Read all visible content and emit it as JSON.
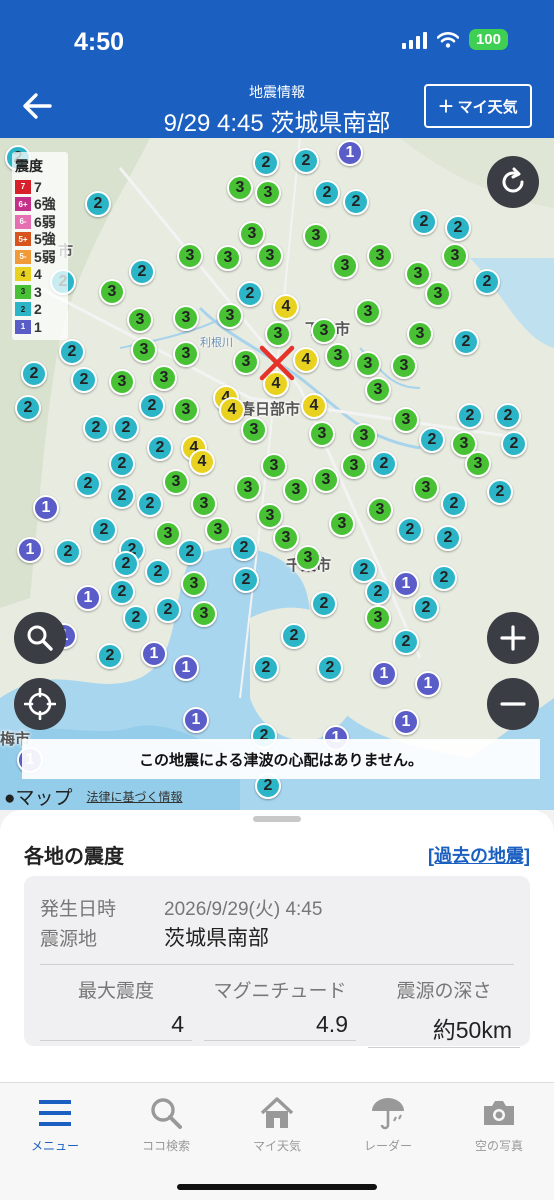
{
  "status_bar": {
    "time": "4:50",
    "battery": "100"
  },
  "header": {
    "subtitle": "地震情報",
    "title": "9/29 4:45 茨城県南部",
    "my_weather_label": "マイ天気"
  },
  "colors": {
    "header_bg": "#1b5fc1",
    "int1": "#5a5cc8",
    "int2": "#2bb5c7",
    "int3": "#48c234",
    "int4": "#e8d21f",
    "link": "#1b5fc1"
  },
  "map": {
    "legend_title": "震度",
    "legend": [
      {
        "sw": "7",
        "label": "7",
        "bg": "#d8202a",
        "fg": "#fff"
      },
      {
        "sw": "6+",
        "label": "6強",
        "bg": "#c42f8a",
        "fg": "#fff"
      },
      {
        "sw": "6-",
        "label": "6弱",
        "bg": "#e56fb0",
        "fg": "#fff"
      },
      {
        "sw": "5+",
        "label": "5強",
        "bg": "#d8541e",
        "fg": "#fff"
      },
      {
        "sw": "5-",
        "label": "5弱",
        "bg": "#f09a3a",
        "fg": "#fff"
      },
      {
        "sw": "4",
        "label": "4",
        "bg": "#e8d21f",
        "fg": "#222"
      },
      {
        "sw": "3",
        "label": "3",
        "bg": "#48c234",
        "fg": "#222"
      },
      {
        "sw": "2",
        "label": "2",
        "bg": "#2bb5c7",
        "fg": "#222"
      },
      {
        "sw": "1",
        "label": "1",
        "bg": "#5a5cc8",
        "fg": "#fff"
      }
    ],
    "city_labels": {
      "shimotsuma": "下妻市",
      "kasukabe": "春日部市",
      "chiba": "千葉市",
      "iruma_partial": "市",
      "ome_partial": "梅市",
      "river": "利根川"
    },
    "tsunami_message": "この地震による津波の心配はありません。",
    "apple_maps": "マップ",
    "legal_link": "法律に基づく情報"
  },
  "sheet": {
    "title": "各地の震度",
    "past_link": "[過去の地震]",
    "occurred_label": "発生日時",
    "occurred_value": "2026/9/29(火) 4:45",
    "epicenter_label": "震源地",
    "epicenter_value": "茨城県南部",
    "max_intensity_label": "最大震度",
    "max_intensity_value": "4",
    "magnitude_label": "マグニチュード",
    "magnitude_value": "4.9",
    "depth_label": "震源の深さ",
    "depth_value": "約50km"
  },
  "nav": [
    {
      "label": "メニュー",
      "icon": "menu-icon",
      "active": true
    },
    {
      "label": "ココ検索",
      "icon": "search-icon",
      "active": false
    },
    {
      "label": "マイ天気",
      "icon": "home-icon",
      "active": false
    },
    {
      "label": "レーダー",
      "icon": "umbrella-icon",
      "active": false
    },
    {
      "label": "空の写真",
      "icon": "camera-icon",
      "active": false
    }
  ],
  "stations": [
    [
      18,
      20,
      "2"
    ],
    [
      350,
      15,
      "1"
    ],
    [
      306,
      23,
      "2"
    ],
    [
      266,
      25,
      "2"
    ],
    [
      240,
      50,
      "3"
    ],
    [
      268,
      55,
      "3"
    ],
    [
      327,
      55,
      "2"
    ],
    [
      98,
      66,
      "2"
    ],
    [
      356,
      64,
      "2"
    ],
    [
      512,
      44,
      "2"
    ],
    [
      424,
      84,
      "2"
    ],
    [
      458,
      90,
      "2"
    ],
    [
      252,
      96,
      "3"
    ],
    [
      316,
      98,
      "3"
    ],
    [
      380,
      118,
      "3"
    ],
    [
      455,
      118,
      "3"
    ],
    [
      190,
      118,
      "3"
    ],
    [
      228,
      120,
      "3"
    ],
    [
      270,
      118,
      "3"
    ],
    [
      345,
      128,
      "3"
    ],
    [
      142,
      134,
      "2"
    ],
    [
      418,
      136,
      "3"
    ],
    [
      63,
      144,
      "2"
    ],
    [
      487,
      144,
      "2"
    ],
    [
      112,
      154,
      "3"
    ],
    [
      250,
      156,
      "2"
    ],
    [
      286,
      169,
      "4"
    ],
    [
      438,
      156,
      "3"
    ],
    [
      140,
      182,
      "3"
    ],
    [
      186,
      180,
      "3"
    ],
    [
      230,
      178,
      "3"
    ],
    [
      368,
      174,
      "3"
    ],
    [
      324,
      193,
      "3"
    ],
    [
      278,
      196,
      "3"
    ],
    [
      420,
      196,
      "3"
    ],
    [
      466,
      204,
      "2"
    ],
    [
      144,
      212,
      "3"
    ],
    [
      186,
      216,
      "3"
    ],
    [
      72,
      214,
      "2"
    ],
    [
      246,
      224,
      "3"
    ],
    [
      338,
      218,
      "3"
    ],
    [
      306,
      222,
      "4"
    ],
    [
      368,
      226,
      "3"
    ],
    [
      404,
      228,
      "3"
    ],
    [
      34,
      236,
      "2"
    ],
    [
      84,
      242,
      "2"
    ],
    [
      122,
      244,
      "3"
    ],
    [
      164,
      240,
      "3"
    ],
    [
      276,
      246,
      "4"
    ],
    [
      378,
      252,
      "3"
    ],
    [
      226,
      260,
      "4"
    ],
    [
      28,
      270,
      "2"
    ],
    [
      152,
      268,
      "2"
    ],
    [
      186,
      272,
      "3"
    ],
    [
      232,
      272,
      "4"
    ],
    [
      314,
      268,
      "4"
    ],
    [
      470,
      278,
      "2"
    ],
    [
      508,
      278,
      "2"
    ],
    [
      96,
      290,
      "2"
    ],
    [
      126,
      290,
      "2"
    ],
    [
      254,
      292,
      "3"
    ],
    [
      322,
      296,
      "3"
    ],
    [
      364,
      298,
      "3"
    ],
    [
      406,
      282,
      "3"
    ],
    [
      432,
      302,
      "2"
    ],
    [
      464,
      306,
      "3"
    ],
    [
      514,
      306,
      "2"
    ],
    [
      160,
      310,
      "2"
    ],
    [
      194,
      310,
      "4"
    ],
    [
      202,
      324,
      "4"
    ],
    [
      122,
      326,
      "2"
    ],
    [
      274,
      328,
      "3"
    ],
    [
      354,
      328,
      "3"
    ],
    [
      384,
      326,
      "2"
    ],
    [
      478,
      326,
      "3"
    ],
    [
      176,
      344,
      "3"
    ],
    [
      248,
      350,
      "3"
    ],
    [
      326,
      342,
      "3"
    ],
    [
      296,
      352,
      "3"
    ],
    [
      88,
      346,
      "2"
    ],
    [
      426,
      350,
      "3"
    ],
    [
      122,
      358,
      "2"
    ],
    [
      150,
      366,
      "2"
    ],
    [
      204,
      366,
      "3"
    ],
    [
      380,
      372,
      "3"
    ],
    [
      454,
      366,
      "2"
    ],
    [
      500,
      354,
      "2"
    ],
    [
      46,
      370,
      "1"
    ],
    [
      270,
      378,
      "3"
    ],
    [
      342,
      386,
      "3"
    ],
    [
      218,
      392,
      "3"
    ],
    [
      168,
      396,
      "3"
    ],
    [
      286,
      400,
      "3"
    ],
    [
      104,
      392,
      "2"
    ],
    [
      410,
      392,
      "2"
    ],
    [
      448,
      400,
      "2"
    ],
    [
      30,
      412,
      "1"
    ],
    [
      68,
      414,
      "2"
    ],
    [
      132,
      412,
      "2"
    ],
    [
      190,
      414,
      "2"
    ],
    [
      244,
      410,
      "2"
    ],
    [
      308,
      420,
      "3"
    ],
    [
      364,
      432,
      "2"
    ],
    [
      126,
      426,
      "2"
    ],
    [
      158,
      434,
      "2"
    ],
    [
      194,
      446,
      "3"
    ],
    [
      246,
      442,
      "2"
    ],
    [
      406,
      446,
      "1"
    ],
    [
      444,
      440,
      "2"
    ],
    [
      122,
      454,
      "2"
    ],
    [
      88,
      460,
      "1"
    ],
    [
      378,
      454,
      "2"
    ],
    [
      324,
      466,
      "2"
    ],
    [
      136,
      480,
      "2"
    ],
    [
      168,
      472,
      "2"
    ],
    [
      204,
      476,
      "3"
    ],
    [
      426,
      470,
      "2"
    ],
    [
      378,
      480,
      "3"
    ],
    [
      64,
      498,
      "1"
    ],
    [
      294,
      498,
      "2"
    ],
    [
      406,
      504,
      "2"
    ],
    [
      110,
      518,
      "2"
    ],
    [
      154,
      516,
      "1"
    ],
    [
      186,
      530,
      "1"
    ],
    [
      266,
      530,
      "2"
    ],
    [
      330,
      530,
      "2"
    ],
    [
      384,
      536,
      "1"
    ],
    [
      428,
      546,
      "1"
    ],
    [
      196,
      582,
      "1"
    ],
    [
      406,
      584,
      "1"
    ],
    [
      264,
      598,
      "2"
    ],
    [
      336,
      600,
      "1"
    ],
    [
      30,
      622,
      "1"
    ],
    [
      268,
      648,
      "2"
    ]
  ]
}
